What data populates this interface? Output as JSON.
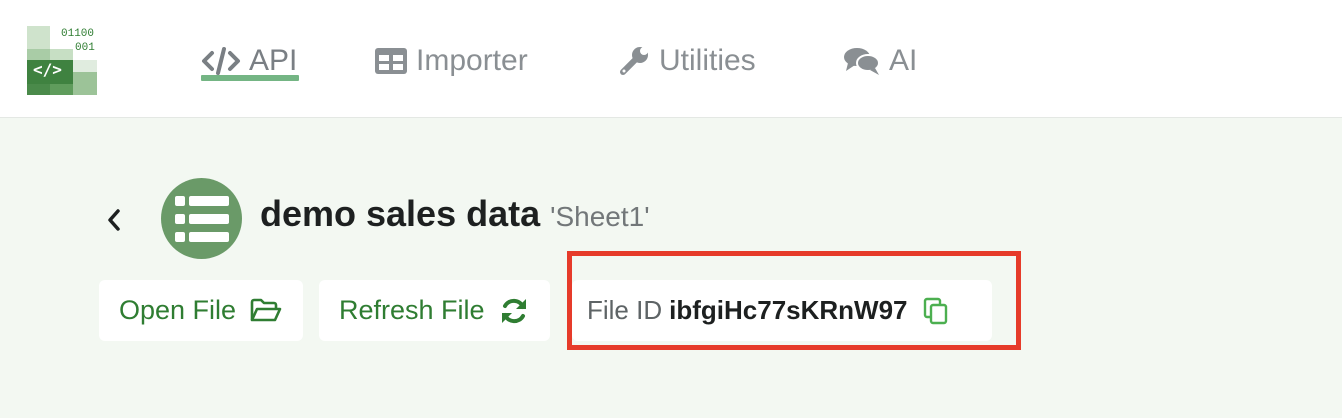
{
  "logo": {
    "bits_line1": "01100",
    "bits_line2": "001",
    "code_glyph": "</>"
  },
  "nav": {
    "items": [
      {
        "label": "API",
        "icon": "code-icon",
        "active": true
      },
      {
        "label": "Importer",
        "icon": "table-icon",
        "active": false
      },
      {
        "label": "Utilities",
        "icon": "wrench-icon",
        "active": false
      },
      {
        "label": "AI",
        "icon": "chat-bubbles-icon",
        "active": false
      }
    ]
  },
  "file": {
    "name": "demo sales data",
    "sheet": "'Sheet1'",
    "avatar_icon": "list-icon",
    "back_icon": "chevron-left-icon"
  },
  "actions": {
    "open_label": "Open File",
    "open_icon": "folder-open-icon",
    "refresh_label": "Refresh File",
    "refresh_icon": "refresh-icon"
  },
  "file_id": {
    "label": "File ID",
    "value": "ibfgiHc77sKRnW97",
    "copy_icon": "copy-icon"
  },
  "colors": {
    "accent_green": "#2f7d32",
    "avatar_green": "#6a9a68",
    "underline_green": "#74b584",
    "highlight_red": "#e63b2a",
    "page_bg": "#f3f8f2"
  }
}
